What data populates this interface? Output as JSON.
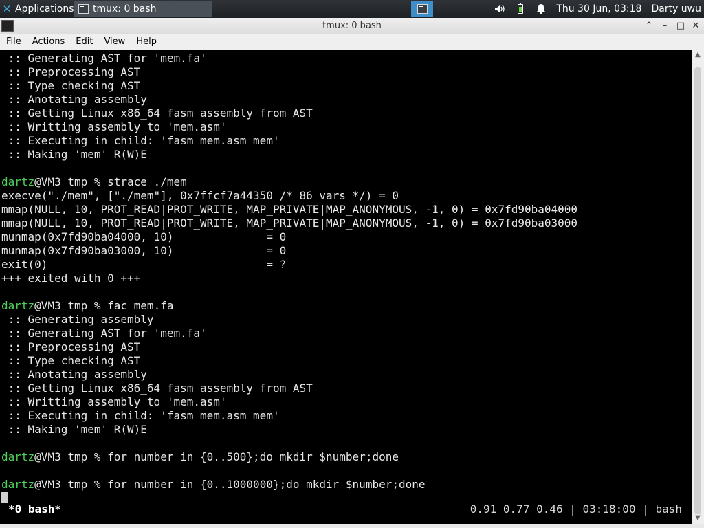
{
  "panel": {
    "apps_label": "Applications",
    "task_label": "tmux: 0 bash",
    "datetime": "Thu 30 Jun, 03:18",
    "user": "Darty uwu",
    "icons": {
      "apps": "xfce-icon",
      "volume": "volume-icon",
      "battery": "battery-icon",
      "notify": "bell-icon"
    }
  },
  "window": {
    "title": "tmux: 0 bash",
    "menu": [
      "File",
      "Actions",
      "Edit",
      "View",
      "Help"
    ]
  },
  "terminal": {
    "lines": [
      {
        "p": "",
        "t": " :: Generating AST for 'mem.fa'"
      },
      {
        "p": "",
        "t": " :: Preprocessing AST"
      },
      {
        "p": "",
        "t": " :: Type checking AST"
      },
      {
        "p": "",
        "t": " :: Anotating assembly"
      },
      {
        "p": "",
        "t": " :: Getting Linux x86_64 fasm assembly from AST"
      },
      {
        "p": "",
        "t": " :: Writting assembly to 'mem.asm'"
      },
      {
        "p": "",
        "t": " :: Executing in child: 'fasm mem.asm mem'"
      },
      {
        "p": "",
        "t": " :: Making 'mem' R(W)E"
      },
      {
        "p": "",
        "t": ""
      },
      {
        "p": "dartz",
        "t": "@VM3 tmp % strace ./mem"
      },
      {
        "p": "",
        "t": "execve(\"./mem\", [\"./mem\"], 0x7ffcf7a44350 /* 86 vars */) = 0"
      },
      {
        "p": "",
        "t": "mmap(NULL, 10, PROT_READ|PROT_WRITE, MAP_PRIVATE|MAP_ANONYMOUS, -1, 0) = 0x7fd90ba04000"
      },
      {
        "p": "",
        "t": "mmap(NULL, 10, PROT_READ|PROT_WRITE, MAP_PRIVATE|MAP_ANONYMOUS, -1, 0) = 0x7fd90ba03000"
      },
      {
        "p": "",
        "t": "munmap(0x7fd90ba04000, 10)              = 0"
      },
      {
        "p": "",
        "t": "munmap(0x7fd90ba03000, 10)              = 0"
      },
      {
        "p": "",
        "t": "exit(0)                                 = ?"
      },
      {
        "p": "",
        "t": "+++ exited with 0 +++"
      },
      {
        "p": "",
        "t": ""
      },
      {
        "p": "dartz",
        "t": "@VM3 tmp % fac mem.fa"
      },
      {
        "p": "",
        "t": " :: Generating assembly"
      },
      {
        "p": "",
        "t": " :: Generating AST for 'mem.fa'"
      },
      {
        "p": "",
        "t": " :: Preprocessing AST"
      },
      {
        "p": "",
        "t": " :: Type checking AST"
      },
      {
        "p": "",
        "t": " :: Anotating assembly"
      },
      {
        "p": "",
        "t": " :: Getting Linux x86_64 fasm assembly from AST"
      },
      {
        "p": "",
        "t": " :: Writting assembly to 'mem.asm'"
      },
      {
        "p": "",
        "t": " :: Executing in child: 'fasm mem.asm mem'"
      },
      {
        "p": "",
        "t": " :: Making 'mem' R(W)E"
      },
      {
        "p": "",
        "t": ""
      },
      {
        "p": "dartz",
        "t": "@VM3 tmp % for number in {0..500};do mkdir $number;done"
      },
      {
        "p": "",
        "t": ""
      },
      {
        "p": "dartz",
        "t": "@VM3 tmp % for number in {0..1000000};do mkdir $number;done"
      }
    ]
  },
  "tmux": {
    "window_label": "*0 bash*",
    "right": "0.91 0.77 0.46 | 03:18:00 | bash"
  }
}
